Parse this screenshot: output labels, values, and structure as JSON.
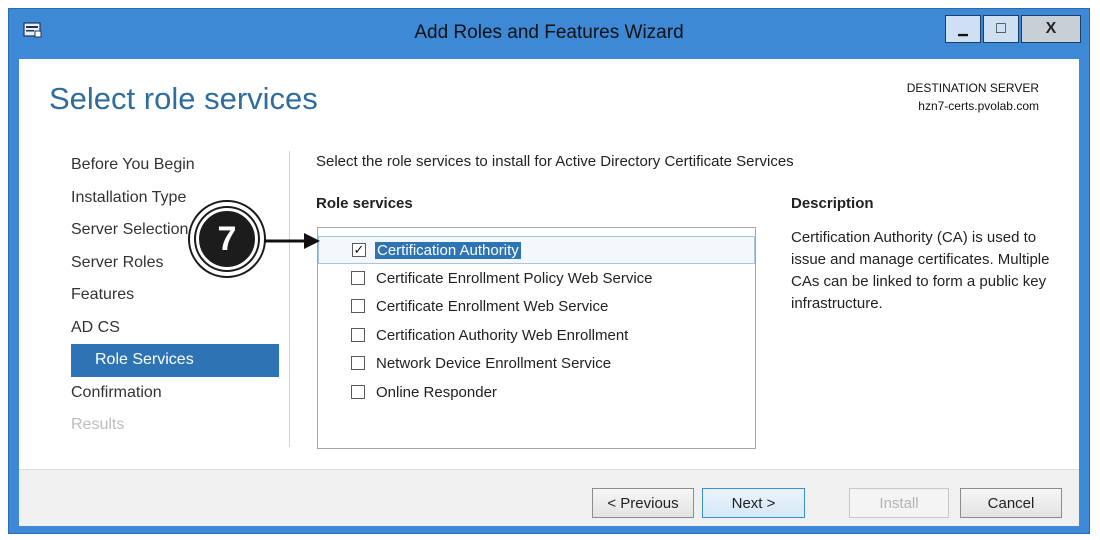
{
  "window": {
    "title": "Add Roles and Features Wizard",
    "minimize_glyph": "▁",
    "maximize_glyph": "□",
    "close_glyph": "X"
  },
  "page_title": "Select role services",
  "destination": {
    "label": "DESTINATION SERVER",
    "server": "hzn7-certs.pvolab.com"
  },
  "nav": {
    "items": [
      {
        "label": "Before You Begin",
        "state": "normal"
      },
      {
        "label": "Installation Type",
        "state": "normal"
      },
      {
        "label": "Server Selection",
        "state": "normal"
      },
      {
        "label": "Server Roles",
        "state": "normal"
      },
      {
        "label": "Features",
        "state": "normal"
      },
      {
        "label": "AD CS",
        "state": "normal"
      },
      {
        "label": "Role Services",
        "state": "active"
      },
      {
        "label": "Confirmation",
        "state": "normal"
      },
      {
        "label": "Results",
        "state": "disabled"
      }
    ]
  },
  "main": {
    "instruction": "Select the role services to install for Active Directory Certificate Services",
    "role_services_header": "Role services",
    "description_header": "Description",
    "role_services": [
      {
        "label": "Certification Authority",
        "checked": true,
        "selected": true
      },
      {
        "label": "Certificate Enrollment Policy Web Service",
        "checked": false,
        "selected": false
      },
      {
        "label": "Certificate Enrollment Web Service",
        "checked": false,
        "selected": false
      },
      {
        "label": "Certification Authority Web Enrollment",
        "checked": false,
        "selected": false
      },
      {
        "label": "Network Device Enrollment Service",
        "checked": false,
        "selected": false
      },
      {
        "label": "Online Responder",
        "checked": false,
        "selected": false
      }
    ],
    "description": "Certification Authority (CA) is used to issue and manage certificates. Multiple CAs can be linked to form a public key infrastructure.",
    "checkmark_glyph": "✓"
  },
  "footer": {
    "previous": "< Previous",
    "next": "Next >",
    "install": "Install",
    "cancel": "Cancel"
  },
  "callout": {
    "number": "7"
  },
  "colors": {
    "title_bar": "#3e89d6",
    "accent": "#2e74b5",
    "page_title": "#2f6d9e"
  }
}
